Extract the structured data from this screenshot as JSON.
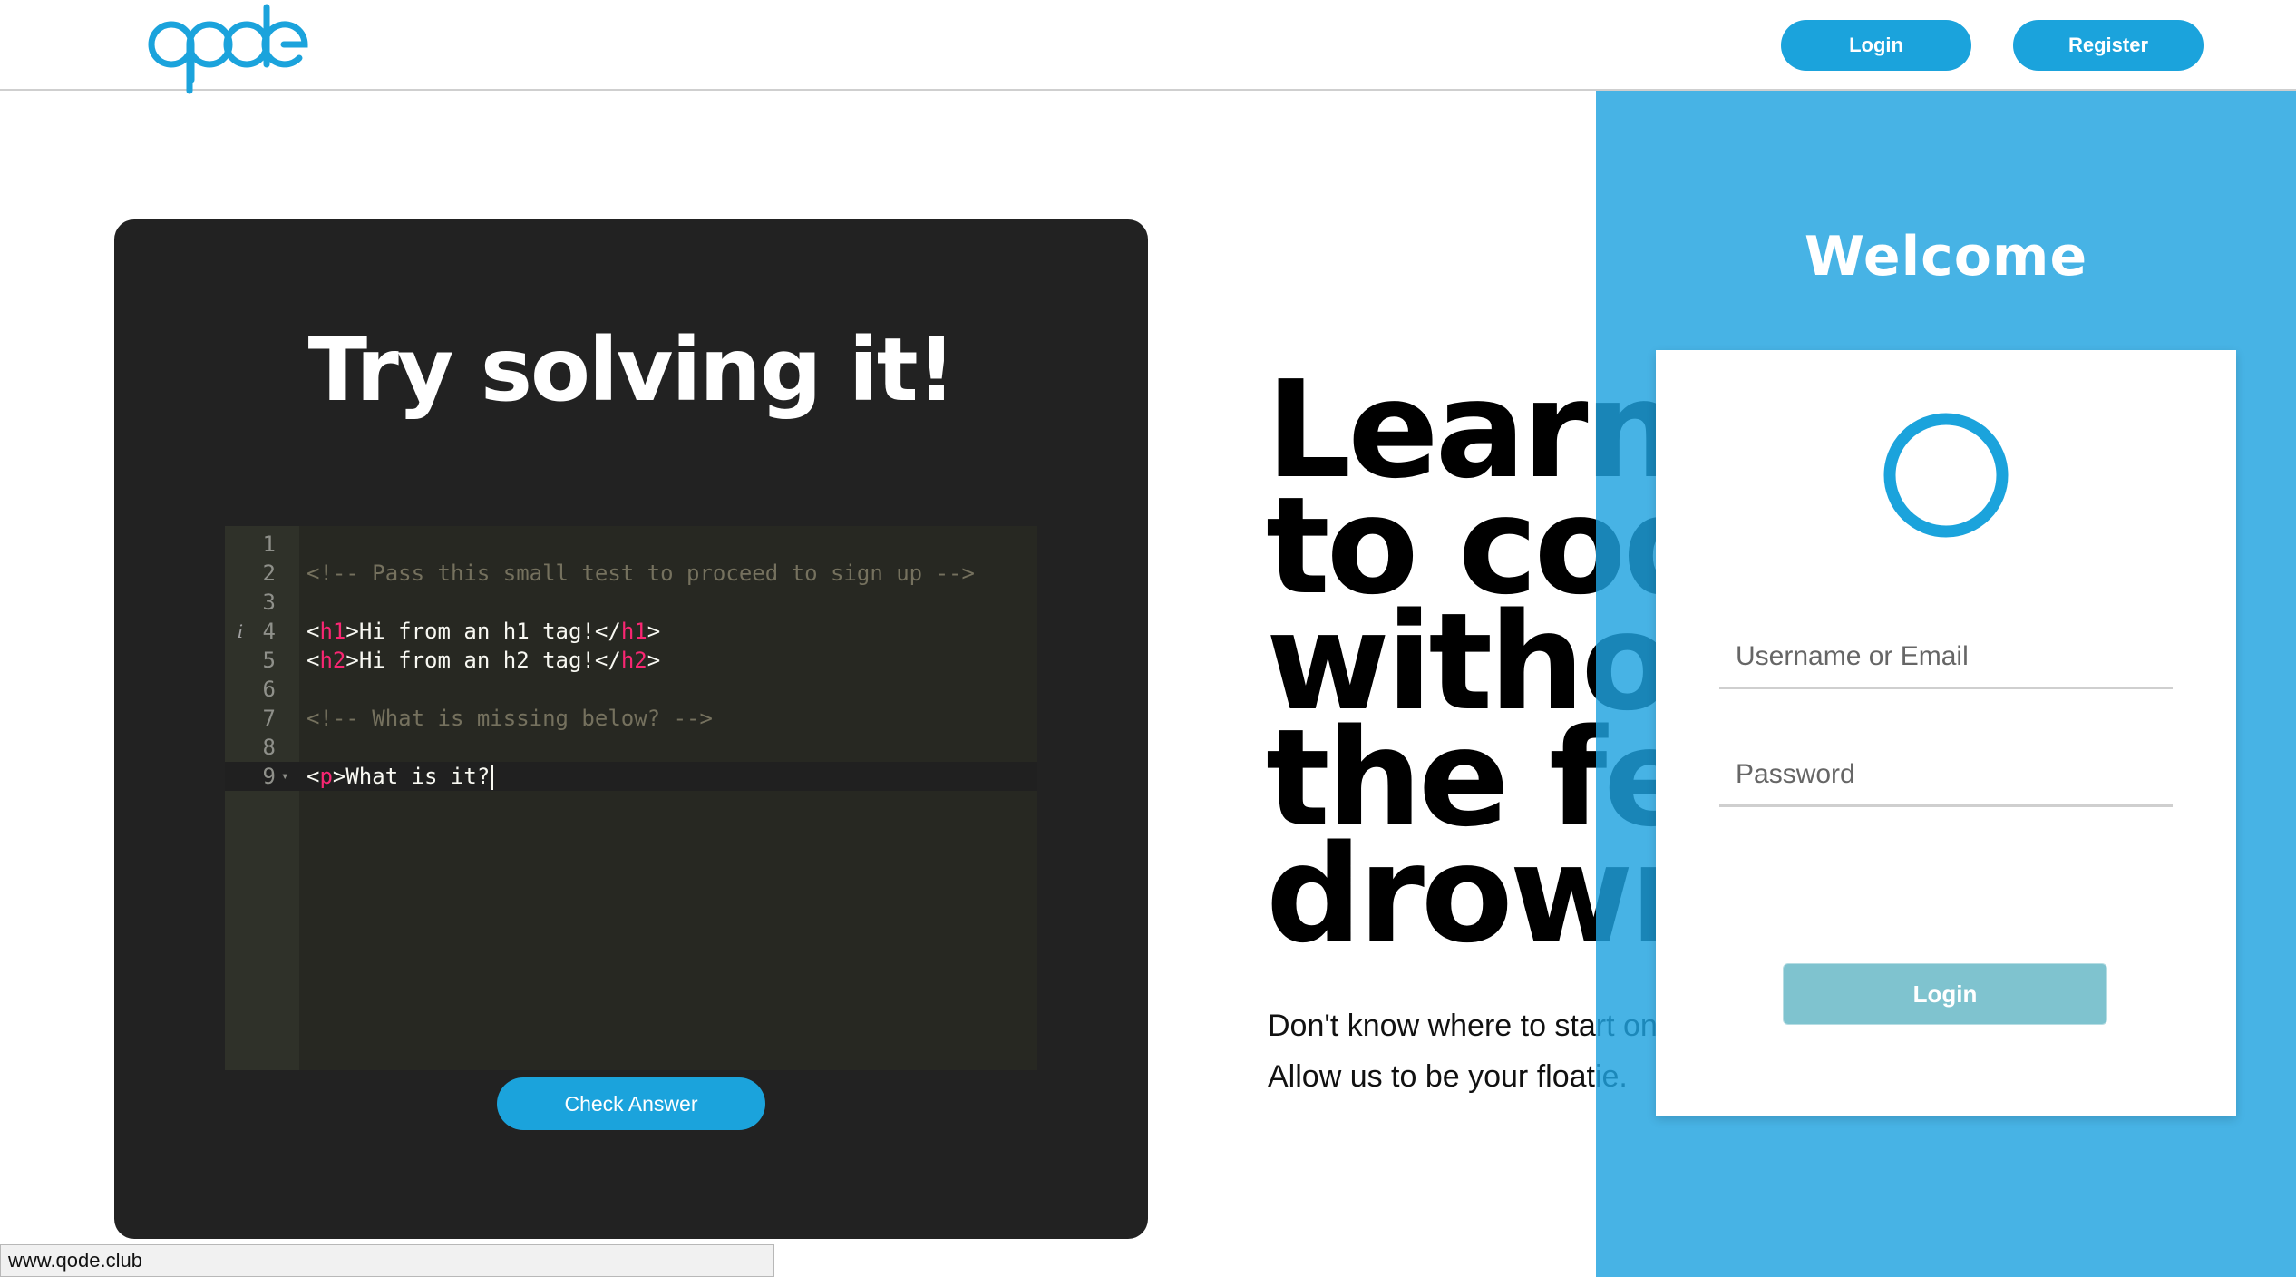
{
  "navbar": {
    "logo_text": "qode",
    "login_label": "Login",
    "register_label": "Register"
  },
  "colors": {
    "brand": "#1ba3dc",
    "panel": "#1fa2df",
    "card": "#222222",
    "editor_bg": "#272822",
    "login_button": "#7fc3cf"
  },
  "challenge": {
    "title": "Try solving it!",
    "check_label": "Check Answer",
    "code_lines": [
      {
        "num": "1",
        "tokens": []
      },
      {
        "num": "2",
        "tokens": [
          {
            "t": "comment",
            "v": "<!-- Pass this small test to proceed to sign up -->"
          }
        ]
      },
      {
        "num": "3",
        "tokens": []
      },
      {
        "num": "4",
        "marker": "i",
        "tokens": [
          {
            "t": "punc",
            "v": "<"
          },
          {
            "t": "tag",
            "v": "h1"
          },
          {
            "t": "punc",
            "v": ">"
          },
          {
            "t": "text",
            "v": "Hi from an h1 tag!"
          },
          {
            "t": "punc",
            "v": "</"
          },
          {
            "t": "tag",
            "v": "h1"
          },
          {
            "t": "punc",
            "v": ">"
          }
        ]
      },
      {
        "num": "5",
        "tokens": [
          {
            "t": "punc",
            "v": "<"
          },
          {
            "t": "tag",
            "v": "h2"
          },
          {
            "t": "punc",
            "v": ">"
          },
          {
            "t": "text",
            "v": "Hi from an h2 tag!"
          },
          {
            "t": "punc",
            "v": "</"
          },
          {
            "t": "tag",
            "v": "h2"
          },
          {
            "t": "punc",
            "v": ">"
          }
        ]
      },
      {
        "num": "6",
        "tokens": []
      },
      {
        "num": "7",
        "tokens": [
          {
            "t": "comment",
            "v": "<!-- What is missing below? -->"
          }
        ]
      },
      {
        "num": "8",
        "tokens": []
      },
      {
        "num": "9",
        "fold": true,
        "active": true,
        "cursor": true,
        "tokens": [
          {
            "t": "punc",
            "v": "<"
          },
          {
            "t": "tag",
            "v": "p"
          },
          {
            "t": "punc",
            "v": ">"
          },
          {
            "t": "text",
            "v": "What is it?"
          }
        ]
      }
    ]
  },
  "hero": {
    "lines": [
      "Learn",
      "to code",
      "without",
      "the fear of",
      "drowning"
    ],
    "subtitle_1": "Don't know where to start on",
    "subtitle_2": "Allow us to be your floatie."
  },
  "login_panel": {
    "welcome": "Welcome",
    "username_placeholder": "Username or Email",
    "password_placeholder": "Password",
    "submit_label": "Login"
  },
  "status_bar": {
    "url": "www.qode.club"
  }
}
